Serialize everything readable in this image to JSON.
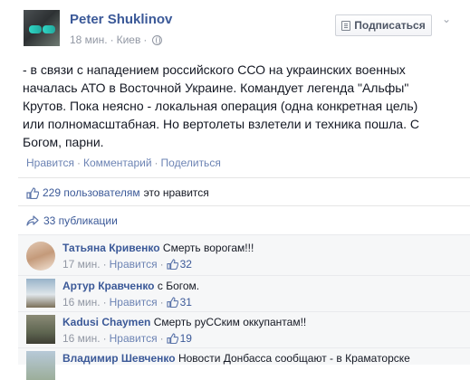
{
  "post": {
    "author": "Peter Shuklinov",
    "time": "18 мин.",
    "location": "Киев",
    "subscribe_label": "Подписаться",
    "text": "- в связи с нападением российского ССО на украинских военных\nначалась АТО в Восточной Украине. Командует легенда \"Альфы\"\nКрутов. Пока неясно - локальная операция (одна конкретная цель)\nили полномасштабная. Но вертолеты взлетели и техника пошла. С\nБогом, парни.",
    "actions": {
      "like": "Нравится",
      "comment": "Комментарий",
      "share": "Поделиться"
    },
    "likes_count_text": "229 пользователям",
    "likes_suffix": "это нравится",
    "shares_text": "33 публикации",
    "icons": {
      "privacy": "globe-icon",
      "subscribe": "rss-icon",
      "menu": "chevron-down-icon",
      "like": "thumbs-up-icon",
      "share": "share-arrow-icon"
    },
    "colors": {
      "link": "#3b5998",
      "muted": "#9197a3",
      "comment_bg": "#f6f7f8"
    }
  },
  "comments": [
    {
      "name": "Татьяна Кривенко",
      "text": "Смерть ворогам!!!",
      "time": "17 мин.",
      "like": "Нравится",
      "likes": "32"
    },
    {
      "name": "Артур Кравченко",
      "text": "с Богом.",
      "time": "16 мин.",
      "like": "Нравится",
      "likes": "31"
    },
    {
      "name": "Kadusi Chaymen",
      "text": "Смерть руССким оккупантам!!",
      "time": "16 мин.",
      "like": "Нравится",
      "likes": "19"
    },
    {
      "name": "Владимир Шевченко",
      "text": "Новости Донбасса сообщают - в Краматорске",
      "time": "",
      "like": "",
      "likes": ""
    }
  ]
}
